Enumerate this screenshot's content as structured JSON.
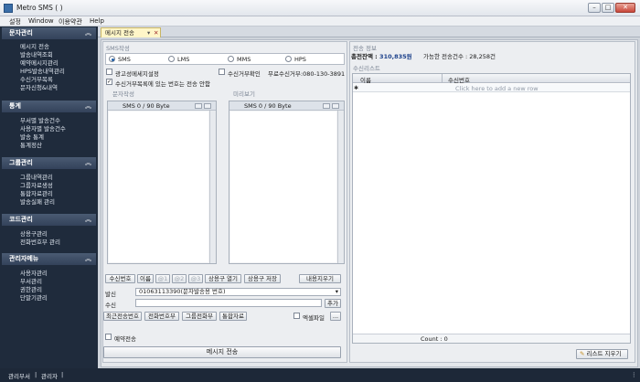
{
  "window": {
    "title": "Metro SMS (                              )"
  },
  "menu": {
    "items": [
      "설정",
      "Window",
      "이용약관",
      "Help"
    ]
  },
  "sidebar": {
    "sections": [
      {
        "title": "문자관리",
        "items": [
          "메시지 전송",
          "발송내역조회",
          "예약메시지관리",
          "HPS발송내역관리",
          "수신거부목록",
          "문자신청&내역"
        ]
      },
      {
        "title": "통계",
        "items": [
          "부서별 발송건수",
          "사용자별 발송건수",
          "발송 통계",
          "통계정산"
        ]
      },
      {
        "title": "그룹관리",
        "items": [
          "그룹내역관리",
          "그룹자료생성",
          "통합자료관리",
          "발송실패 관리"
        ]
      },
      {
        "title": "코드관리",
        "items": [
          "상용구관리",
          "전화번호부 관리"
        ]
      },
      {
        "title": "관리자메뉴",
        "items": [
          "사용자관리",
          "부서관리",
          "권한관리",
          "단말기관리"
        ]
      }
    ]
  },
  "tab": {
    "label": "메시지 전송"
  },
  "sms": {
    "group_label": "SMS작성",
    "types": [
      "SMS",
      "LMS",
      "MMS",
      "HPS"
    ],
    "selected_type": "SMS",
    "ad_checkbox_label": "광고성메세지설정",
    "reject_check_label": "수신거부확인",
    "reject_free_text": "무료수신거부:080-130-3891",
    "exclude_reject_label": "수신거부목록에 있는 번호는 전송 안함",
    "compose_label": "문자작성",
    "preview_label": "미리보기",
    "compose_counter": "SMS 0 / 90 Byte",
    "preview_counter": "SMS 0 / 90 Byte",
    "buttons": {
      "receiver_no": "수신번호",
      "name": "이름",
      "f1": "@1",
      "f2": "@2",
      "f3": "@3",
      "phrase_open": "상용구 열기",
      "phrase_save": "상용구 저장",
      "clear": "내용지우기",
      "add": "추가",
      "recent": "최근전송번호",
      "phonebook": "전화번호부",
      "group_phonebook": "그룹전화부",
      "integrated": "통합자료",
      "excel": "엑셀파일",
      "more": "...",
      "send": "메시지 전송"
    },
    "sender_label": "발신",
    "sender_value": "01063113390(문자발송용 번호)",
    "receiver_label": "수신",
    "receiver_value": "",
    "reserve_label": "예약전송"
  },
  "sendinfo": {
    "group_label": "전송 정보",
    "balance_label": "총전잔액 : ",
    "balance_value": "310,835원",
    "available_text": "가능한 전송건수 : 28,258건"
  },
  "recipients": {
    "group_label": "수신리스트",
    "columns": [
      "이름",
      "수신번호"
    ],
    "new_row_hint": "Click here to add a new row",
    "count_text": "Count : 0",
    "clear_button": "리스트 지우기"
  },
  "status": {
    "dept": "관리부서",
    "user": "관리자"
  }
}
